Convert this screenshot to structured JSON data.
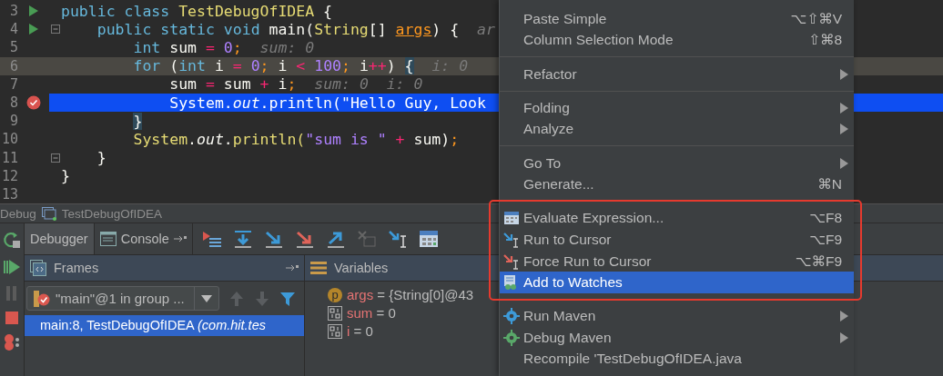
{
  "editor": {
    "lines": [
      {
        "number": "3",
        "run_marker": true,
        "fold_marker": false,
        "breakpoint": false,
        "current": false,
        "tokens": [
          {
            "text": "public class ",
            "kind": "kw"
          },
          {
            "text": "TestDebugOfIDEA",
            "kind": "type"
          },
          {
            "text": " {",
            "kind": "plain"
          }
        ]
      },
      {
        "number": "4",
        "run_marker": true,
        "fold_marker": true,
        "breakpoint": false,
        "current": false,
        "tokens": [
          {
            "text": "    public static void ",
            "kind": "kw"
          },
          {
            "text": "main(",
            "kind": "plain"
          },
          {
            "text": "String",
            "kind": "type"
          },
          {
            "text": "[] ",
            "kind": "plain"
          },
          {
            "text": "args",
            "kind": "param"
          },
          {
            "text": ") {",
            "kind": "plain"
          },
          {
            "text": "  ar",
            "kind": "hint"
          }
        ]
      },
      {
        "number": "5",
        "run_marker": false,
        "fold_marker": false,
        "breakpoint": false,
        "current": false,
        "tokens": [
          {
            "text": "        int ",
            "kind": "kw"
          },
          {
            "text": "sum ",
            "kind": "plain"
          },
          {
            "text": "=",
            "kind": "op"
          },
          {
            "text": " 0",
            "kind": "num"
          },
          {
            "text": ";",
            "kind": "punct"
          },
          {
            "text": "  sum: 0",
            "kind": "hint"
          }
        ]
      },
      {
        "number": "6",
        "run_marker": false,
        "fold_marker": false,
        "breakpoint": false,
        "current": true,
        "tokens": [
          {
            "text": "        for ",
            "kind": "kw"
          },
          {
            "text": "(",
            "kind": "plain"
          },
          {
            "text": "int ",
            "kind": "kw"
          },
          {
            "text": "i ",
            "kind": "plain"
          },
          {
            "text": "=",
            "kind": "op"
          },
          {
            "text": " 0",
            "kind": "num"
          },
          {
            "text": ";",
            "kind": "punct"
          },
          {
            "text": " i ",
            "kind": "plain"
          },
          {
            "text": "<",
            "kind": "op"
          },
          {
            "text": " 100",
            "kind": "num"
          },
          {
            "text": ";",
            "kind": "punct"
          },
          {
            "text": " i",
            "kind": "plain"
          },
          {
            "text": "++",
            "kind": "op"
          },
          {
            "text": ") ",
            "kind": "plain"
          },
          {
            "text": "{",
            "kind": "brace"
          },
          {
            "text": "  i: 0",
            "kind": "hint"
          }
        ]
      },
      {
        "number": "7",
        "run_marker": false,
        "fold_marker": false,
        "breakpoint": false,
        "current": false,
        "tokens": [
          {
            "text": "            sum ",
            "kind": "plain"
          },
          {
            "text": "=",
            "kind": "op"
          },
          {
            "text": " sum ",
            "kind": "plain"
          },
          {
            "text": "+",
            "kind": "op"
          },
          {
            "text": " i",
            "kind": "plain"
          },
          {
            "text": ";",
            "kind": "punct"
          },
          {
            "text": "  sum: 0  i: 0",
            "kind": "hint"
          }
        ]
      },
      {
        "number": "8",
        "run_marker": false,
        "fold_marker": false,
        "breakpoint": true,
        "current": false,
        "tokens": [
          {
            "text": "            System.",
            "kind": "plain"
          },
          {
            "text": "out",
            "kind": "italic"
          },
          {
            "text": ".println(\"Hello Guy, Look",
            "kind": "plain"
          }
        ]
      },
      {
        "number": "9",
        "run_marker": false,
        "fold_marker": false,
        "breakpoint": false,
        "current": false,
        "tokens": [
          {
            "text": "        }",
            "kind": "brace"
          }
        ]
      },
      {
        "number": "10",
        "run_marker": false,
        "fold_marker": false,
        "breakpoint": false,
        "current": false,
        "tokens": [
          {
            "text": "        System",
            "kind": "type"
          },
          {
            "text": ".",
            "kind": "plain"
          },
          {
            "text": "out",
            "kind": "italic"
          },
          {
            "text": ".",
            "kind": "plain"
          },
          {
            "text": "println(",
            "kind": "type"
          },
          {
            "text": "\"sum is \"",
            "kind": "str"
          },
          {
            "text": " +",
            "kind": "op"
          },
          {
            "text": " sum)",
            "kind": "plain"
          },
          {
            "text": ";",
            "kind": "punct"
          }
        ]
      },
      {
        "number": "11",
        "run_marker": false,
        "fold_marker": true,
        "breakpoint": false,
        "current": false,
        "tokens": [
          {
            "text": "    }",
            "kind": "plain"
          }
        ]
      },
      {
        "number": "12",
        "run_marker": false,
        "fold_marker": false,
        "breakpoint": false,
        "current": false,
        "tokens": [
          {
            "text": "}",
            "kind": "plain"
          }
        ]
      },
      {
        "number": "13",
        "run_marker": false,
        "fold_marker": false,
        "breakpoint": false,
        "current": false
      }
    ]
  },
  "debug": {
    "title": "Debug",
    "config": "TestDebugOfIDEA",
    "tabs": [
      {
        "label": "Debugger",
        "selected": true
      },
      {
        "label": "Console",
        "selected": false
      }
    ],
    "frames": {
      "title": "Frames",
      "thread": "\"main\"@1 in group ...",
      "items": [
        {
          "text": "main:8, TestDebugOfIDEA *(com.hit.tes*",
          "selected": true
        }
      ]
    },
    "variables": {
      "title": "Variables",
      "items": [
        {
          "kind": "param",
          "badge": "p",
          "name": "args",
          "value": "= {String[0]@43"
        },
        {
          "kind": "local",
          "name": "sum",
          "value": "= 0"
        },
        {
          "kind": "local",
          "name": "i",
          "value": "= 0"
        }
      ]
    }
  },
  "menu": {
    "highlight_box": true,
    "items": [
      {
        "kind": "item",
        "label": "Paste Simple",
        "shortcut": "⌥⇧⌘V",
        "submenu": false,
        "selected": false
      },
      {
        "kind": "item",
        "label": "Column Selection Mode",
        "shortcut": "⇧⌘8",
        "submenu": false,
        "selected": false
      },
      {
        "kind": "separator"
      },
      {
        "kind": "item",
        "label": "Refactor",
        "submenu": true,
        "selected": false
      },
      {
        "kind": "separator"
      },
      {
        "kind": "item",
        "label": "Folding",
        "submenu": true,
        "selected": false
      },
      {
        "kind": "item",
        "label": "Analyze",
        "submenu": true,
        "selected": false
      },
      {
        "kind": "separator"
      },
      {
        "kind": "item",
        "label": "Go To",
        "submenu": true,
        "selected": false
      },
      {
        "kind": "item",
        "label": "Generate...",
        "shortcut": "⌘N",
        "submenu": false,
        "selected": false
      },
      {
        "kind": "separator"
      },
      {
        "kind": "evaluate",
        "label": "Evaluate Expression...",
        "shortcut": "⌥F8",
        "submenu": false,
        "selected": false
      },
      {
        "kind": "cursor",
        "label": "Run to Cursor",
        "shortcut": "⌥F9",
        "submenu": false,
        "selected": false
      },
      {
        "kind": "force",
        "label": "Force Run to Cursor",
        "shortcut": "⌥⌘F9",
        "submenu": false,
        "selected": false
      },
      {
        "kind": "watch",
        "label": "Add to Watches",
        "submenu": false,
        "selected": true
      },
      {
        "kind": "separator"
      },
      {
        "kind": "maven",
        "label": "Run Maven",
        "submenu": true,
        "selected": false
      },
      {
        "kind": "debug",
        "label": "Debug Maven",
        "submenu": true,
        "selected": false
      },
      {
        "kind": "item",
        "label": "Recompile 'TestDebugOfIDEA.java",
        "submenu": false,
        "selected": false
      }
    ]
  }
}
